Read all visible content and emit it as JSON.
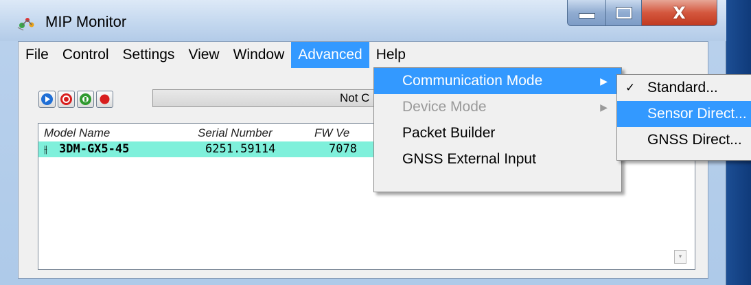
{
  "window": {
    "title": "MIP Monitor",
    "icons": {
      "app": "mip-app-icon",
      "minimize": "minimize-icon",
      "maximize": "maximize-icon",
      "close": "close-icon"
    }
  },
  "menubar": {
    "items": [
      "File",
      "Control",
      "Settings",
      "View",
      "Window",
      "Advanced",
      "Help"
    ],
    "active": "Advanced"
  },
  "toolbar": {
    "buttons": [
      {
        "name": "play-icon",
        "color": "#1f6fd6"
      },
      {
        "name": "stop-icon",
        "color": "#d81e1e"
      },
      {
        "name": "pause-icon",
        "color": "#2f9a2f"
      },
      {
        "name": "record-icon",
        "color": "#d81e1e"
      }
    ],
    "status_text": "Not C"
  },
  "device_list": {
    "columns": [
      "Model Name",
      "Serial Number",
      "FW Ve"
    ],
    "rows": [
      {
        "model": "3DM-GX5-45",
        "serial": "6251.59114",
        "fw": "7078",
        "icon": "device-icon"
      }
    ]
  },
  "advanced_menu": {
    "items": [
      {
        "label": "Communication Mode",
        "submenu": true,
        "highlighted": true,
        "disabled": false
      },
      {
        "label": "Device Mode",
        "submenu": true,
        "highlighted": false,
        "disabled": true
      },
      {
        "label": "Packet Builder",
        "submenu": false,
        "highlighted": false,
        "disabled": false
      },
      {
        "label": "GNSS External Input",
        "submenu": false,
        "highlighted": false,
        "disabled": false
      }
    ]
  },
  "communication_mode_menu": {
    "items": [
      {
        "label": "Standard...",
        "checked": true,
        "highlighted": false
      },
      {
        "label": "Sensor Direct...",
        "checked": false,
        "highlighted": true
      },
      {
        "label": "GNSS Direct...",
        "checked": false,
        "highlighted": false
      }
    ]
  },
  "colors": {
    "highlight": "#3399ff",
    "selected_row": "#7ff0db",
    "disabled_text": "#9a9a9a"
  }
}
